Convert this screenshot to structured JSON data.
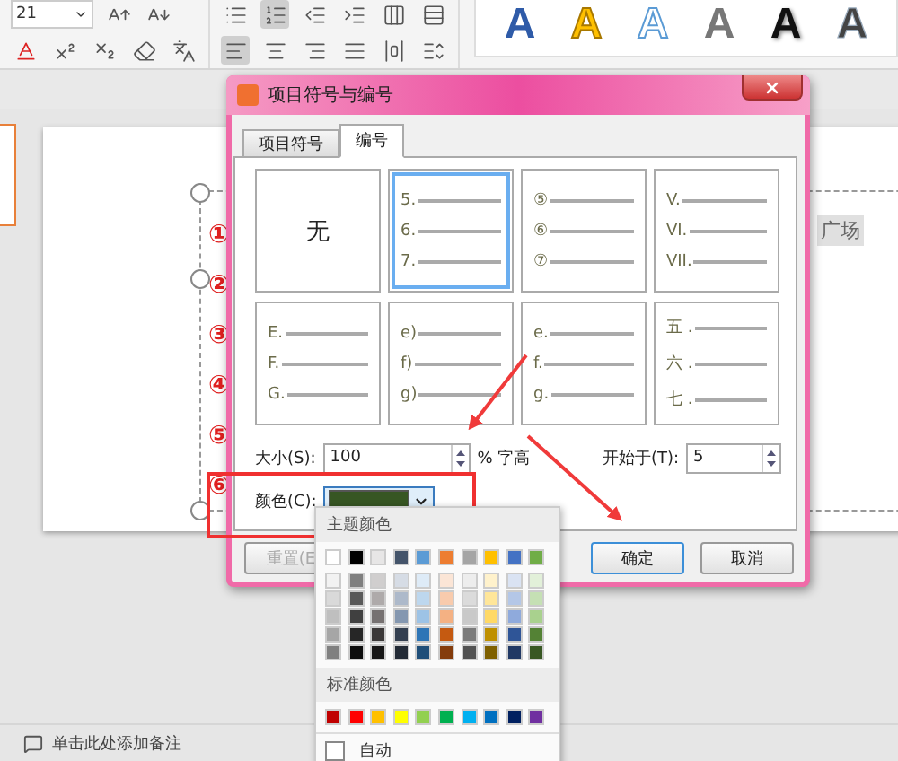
{
  "ribbon": {
    "font_size": "21",
    "style_gallery": [
      {
        "label": "A",
        "kind": "blue-gradient"
      },
      {
        "label": "A",
        "kind": "yellow-outline"
      },
      {
        "label": "A",
        "kind": "blue-outline"
      },
      {
        "label": "A",
        "kind": "gray"
      },
      {
        "label": "A",
        "kind": "black-shadow"
      },
      {
        "label": "A",
        "kind": "dark-outline"
      }
    ]
  },
  "slide": {
    "list_numbers": [
      "①",
      "②",
      "③",
      "④",
      "⑤",
      "⑥"
    ],
    "text_fragment": "广场"
  },
  "dialog": {
    "title": "项目符号与编号",
    "tabs": [
      {
        "label": "项目符号",
        "selected": false
      },
      {
        "label": "编号",
        "selected": true
      }
    ],
    "styles": [
      {
        "kind": "none",
        "label": "无",
        "selected": false
      },
      {
        "kind": "list",
        "lines": [
          "5.",
          "6.",
          "7."
        ],
        "selected": true
      },
      {
        "kind": "list",
        "lines": [
          "⑤",
          "⑥",
          "⑦"
        ],
        "selected": false
      },
      {
        "kind": "list",
        "lines": [
          "V.",
          "VI.",
          "VII."
        ],
        "selected": false
      },
      {
        "kind": "list",
        "lines": [
          "E.",
          "F.",
          "G."
        ],
        "selected": false
      },
      {
        "kind": "list",
        "lines": [
          "e)",
          "f)",
          "g)"
        ],
        "selected": false
      },
      {
        "kind": "list",
        "lines": [
          "e.",
          "f.",
          "g."
        ],
        "selected": false
      },
      {
        "kind": "list",
        "lines": [
          "五 .",
          "六 .",
          "七 ."
        ],
        "selected": false
      }
    ],
    "size": {
      "label": "大小(S):",
      "value": "100",
      "unit": "% 字高"
    },
    "start_at": {
      "label": "开始于(T):",
      "value": "5"
    },
    "color": {
      "label": "颜色(C):",
      "color": "#375623"
    },
    "buttons": [
      {
        "label": "重置(E",
        "disabled": true,
        "default": false
      },
      {
        "label": "确定",
        "disabled": false,
        "default": true
      },
      {
        "label": "取消",
        "disabled": false,
        "default": false
      }
    ]
  },
  "color_menu": {
    "theme_header": "主题颜色",
    "theme_colors": [
      {
        "color": "#ffffff",
        "shades": [
          {
            "color": "#f2f2f2"
          },
          {
            "color": "#d9d9d9"
          },
          {
            "color": "#bfbfbf"
          },
          {
            "color": "#a6a6a6"
          },
          {
            "color": "#808080"
          }
        ]
      },
      {
        "color": "#000000",
        "shades": [
          {
            "color": "#7f7f7f"
          },
          {
            "color": "#595959"
          },
          {
            "color": "#404040"
          },
          {
            "color": "#262626"
          },
          {
            "color": "#0d0d0d"
          }
        ]
      },
      {
        "color": "#e7e6e6",
        "shades": [
          {
            "color": "#d0cece"
          },
          {
            "color": "#aeaaaa"
          },
          {
            "color": "#767171"
          },
          {
            "color": "#3b3838"
          },
          {
            "color": "#171616"
          }
        ]
      },
      {
        "color": "#44546a",
        "shades": [
          {
            "color": "#d6dce5"
          },
          {
            "color": "#adb9ca"
          },
          {
            "color": "#8497b0"
          },
          {
            "color": "#333f50"
          },
          {
            "color": "#222a35"
          }
        ]
      },
      {
        "color": "#5b9bd5",
        "shades": [
          {
            "color": "#deebf7"
          },
          {
            "color": "#bdd7ee"
          },
          {
            "color": "#9dc3e6"
          },
          {
            "color": "#2e75b6"
          },
          {
            "color": "#1f4e79"
          }
        ]
      },
      {
        "color": "#ed7d31",
        "shades": [
          {
            "color": "#fbe5d6"
          },
          {
            "color": "#f8cbad"
          },
          {
            "color": "#f4b183"
          },
          {
            "color": "#c55a11"
          },
          {
            "color": "#843c0c"
          }
        ]
      },
      {
        "color": "#a5a5a5",
        "shades": [
          {
            "color": "#ededed"
          },
          {
            "color": "#dbdbdb"
          },
          {
            "color": "#c9c9c9"
          },
          {
            "color": "#7b7b7b"
          },
          {
            "color": "#525252"
          }
        ]
      },
      {
        "color": "#ffc000",
        "shades": [
          {
            "color": "#fff2cc"
          },
          {
            "color": "#ffe699"
          },
          {
            "color": "#ffd966"
          },
          {
            "color": "#bf9000"
          },
          {
            "color": "#7f6000"
          }
        ]
      },
      {
        "color": "#4472c4",
        "shades": [
          {
            "color": "#dae3f3"
          },
          {
            "color": "#b4c7e7"
          },
          {
            "color": "#8faadc"
          },
          {
            "color": "#2f5597"
          },
          {
            "color": "#203864"
          }
        ]
      },
      {
        "color": "#70ad47",
        "shades": [
          {
            "color": "#e2f0d9"
          },
          {
            "color": "#c5e0b4"
          },
          {
            "color": "#a9d18e"
          },
          {
            "color": "#548235"
          },
          {
            "color": "#385723"
          }
        ]
      }
    ],
    "standard_header": "标准颜色",
    "standard_colors": [
      {
        "color": "#c00000"
      },
      {
        "color": "#ff0000"
      },
      {
        "color": "#ffc000"
      },
      {
        "color": "#ffff00"
      },
      {
        "color": "#92d050"
      },
      {
        "color": "#00b050"
      },
      {
        "color": "#00b0f0"
      },
      {
        "color": "#0070c0"
      },
      {
        "color": "#002060"
      },
      {
        "color": "#7030a0"
      }
    ],
    "auto": {
      "label": "自动",
      "checked": false
    }
  },
  "status_bar": {
    "notes_hint": "单击此处添加备注"
  }
}
